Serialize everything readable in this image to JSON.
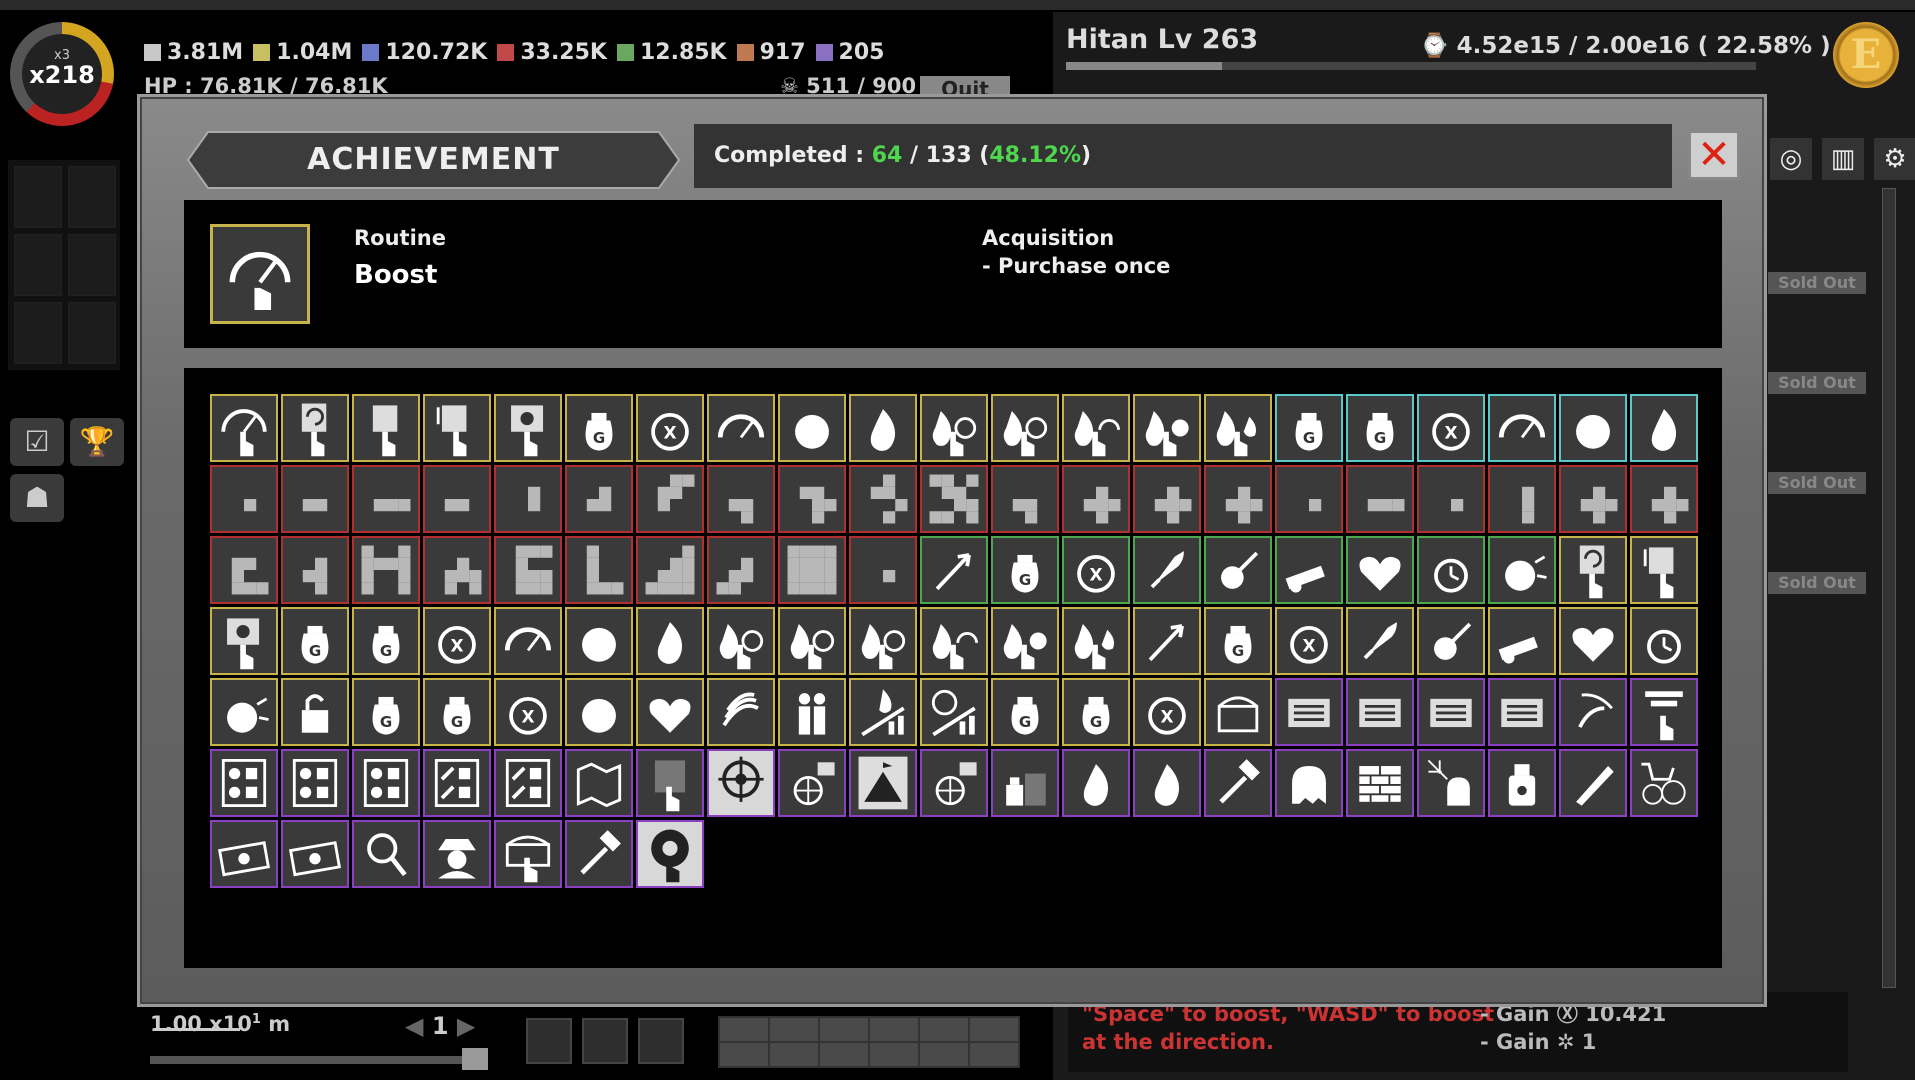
{
  "hud": {
    "multiplier_small": "x3",
    "multiplier_big": "x218",
    "resources": [
      {
        "value": "3.81M",
        "color": "#c8c8c8"
      },
      {
        "value": "1.04M",
        "color": "#c8c060"
      },
      {
        "value": "120.72K",
        "color": "#6a7ac8"
      },
      {
        "value": "33.25K",
        "color": "#c04848"
      },
      {
        "value": "12.85K",
        "color": "#6aa860"
      },
      {
        "value": "917",
        "color": "#c07850"
      },
      {
        "value": "205",
        "color": "#8a70c0"
      }
    ],
    "hp": "HP : 76.81K / 76.81K",
    "kills": "511 / 900",
    "quit_label": "Quit",
    "player": "Hitan  Lv 263",
    "xp": "4.52e15 / 2.00e16  ( 22.58% )",
    "xp_fraction": 0.2258,
    "coin_letter": "E",
    "sold_out": "Sold Out",
    "scale": "1.00 x10",
    "scale_exp": "1",
    "scale_unit": "m",
    "page": "1",
    "hint_line1": "\"Space\" to boost, \"WASD\" to boost",
    "hint_line2": "at the direction.",
    "gain1": "- Gain Ⓧ 10.421",
    "gain2": "- Gain ✲ 1"
  },
  "modal": {
    "title": "ACHIEVEMENT",
    "completed_label": "Completed :",
    "completed_count": "64",
    "completed_total": "/ 133",
    "completed_pct": "48.12%",
    "close_icon": "close-x-icon",
    "accent_green": "#4fd64f",
    "detail": {
      "category": "Routine",
      "name": "Boost",
      "acquisition_title": "Acquisition",
      "acquisition_line": "- Purchase once",
      "icon": "speedometer-hand-icon"
    }
  },
  "achievements": [
    {
      "icon": "speedometer-hand",
      "border": "yellow"
    },
    {
      "icon": "rotate-hand",
      "border": "yellow"
    },
    {
      "icon": "box-hand",
      "border": "yellow"
    },
    {
      "icon": "boxdown-hand",
      "border": "yellow"
    },
    {
      "icon": "gear-hand",
      "border": "yellow"
    },
    {
      "icon": "gold-bag",
      "border": "yellow"
    },
    {
      "icon": "x-bag",
      "border": "yellow"
    },
    {
      "icon": "speedometer",
      "border": "yellow"
    },
    {
      "icon": "ball",
      "border": "yellow"
    },
    {
      "icon": "flame",
      "border": "yellow"
    },
    {
      "icon": "flame-bag",
      "border": "yellow"
    },
    {
      "icon": "flame-x",
      "border": "yellow"
    },
    {
      "icon": "flame-gauge",
      "border": "yellow"
    },
    {
      "icon": "flame-ball",
      "border": "yellow"
    },
    {
      "icon": "flame-flame",
      "border": "yellow"
    },
    {
      "icon": "gold-bag",
      "border": "cyan"
    },
    {
      "icon": "gold-bag",
      "border": "cyan"
    },
    {
      "icon": "x-bag",
      "border": "cyan"
    },
    {
      "icon": "speedometer",
      "border": "cyan"
    },
    {
      "icon": "ball",
      "border": "cyan"
    },
    {
      "icon": "flame",
      "border": "cyan"
    },
    {
      "icon": "pix-a",
      "border": "red"
    },
    {
      "icon": "pix-b",
      "border": "red"
    },
    {
      "icon": "pix-c",
      "border": "red"
    },
    {
      "icon": "pix-b",
      "border": "red"
    },
    {
      "icon": "pix-d",
      "border": "red"
    },
    {
      "icon": "pix-e",
      "border": "red"
    },
    {
      "icon": "pix-f",
      "border": "red"
    },
    {
      "icon": "pix-g",
      "border": "red"
    },
    {
      "icon": "pix-h",
      "border": "red"
    },
    {
      "icon": "pix-i",
      "border": "red"
    },
    {
      "icon": "pix-j",
      "border": "red"
    },
    {
      "icon": "pix-g",
      "border": "red"
    },
    {
      "icon": "pix-plus",
      "border": "red"
    },
    {
      "icon": "pix-plus",
      "border": "red"
    },
    {
      "icon": "pix-plus",
      "border": "red"
    },
    {
      "icon": "pix-a",
      "border": "red"
    },
    {
      "icon": "pix-c",
      "border": "red"
    },
    {
      "icon": "pix-a",
      "border": "red"
    },
    {
      "icon": "pix-k",
      "border": "red"
    },
    {
      "icon": "pix-plus",
      "border": "red"
    },
    {
      "icon": "pix-plus",
      "border": "red"
    },
    {
      "icon": "pix-l",
      "border": "red"
    },
    {
      "icon": "pix-m",
      "border": "red"
    },
    {
      "icon": "pix-n",
      "border": "red"
    },
    {
      "icon": "pix-o",
      "border": "red"
    },
    {
      "icon": "pix-s",
      "border": "red"
    },
    {
      "icon": "pix-p",
      "border": "red"
    },
    {
      "icon": "pix-q",
      "border": "red"
    },
    {
      "icon": "pix-r",
      "border": "red"
    },
    {
      "icon": "pix-block",
      "border": "red"
    },
    {
      "icon": "pix-dot",
      "border": "red"
    },
    {
      "icon": "arrow-up",
      "border": "green"
    },
    {
      "icon": "gold-bag",
      "border": "green"
    },
    {
      "icon": "x-bag",
      "border": "green"
    },
    {
      "icon": "rocket",
      "border": "green"
    },
    {
      "icon": "comet",
      "border": "green"
    },
    {
      "icon": "cannon",
      "border": "green"
    },
    {
      "icon": "heart",
      "border": "green"
    },
    {
      "icon": "clock",
      "border": "green"
    },
    {
      "icon": "explosion",
      "border": "green"
    },
    {
      "icon": "rotate-hand",
      "border": "yellow"
    },
    {
      "icon": "boxdown-hand",
      "border": "yellow"
    },
    {
      "icon": "gear-hand",
      "border": "yellow"
    },
    {
      "icon": "gold-bag",
      "border": "yellow"
    },
    {
      "icon": "gold-bag",
      "border": "yellow"
    },
    {
      "icon": "x-bag",
      "border": "yellow"
    },
    {
      "icon": "speedometer",
      "border": "yellow"
    },
    {
      "icon": "ball",
      "border": "yellow"
    },
    {
      "icon": "flame",
      "border": "yellow"
    },
    {
      "icon": "flame-bag",
      "border": "yellow"
    },
    {
      "icon": "flame-bag",
      "border": "yellow"
    },
    {
      "icon": "flame-x",
      "border": "yellow"
    },
    {
      "icon": "flame-gauge",
      "border": "yellow"
    },
    {
      "icon": "flame-ball",
      "border": "yellow"
    },
    {
      "icon": "flame-flame",
      "border": "yellow"
    },
    {
      "icon": "arrow-up",
      "border": "yellow"
    },
    {
      "icon": "gold-bag",
      "border": "yellow"
    },
    {
      "icon": "x-bag",
      "border": "yellow"
    },
    {
      "icon": "rocket",
      "border": "yellow"
    },
    {
      "icon": "comet",
      "border": "yellow"
    },
    {
      "icon": "cannon",
      "border": "yellow"
    },
    {
      "icon": "heart",
      "border": "yellow"
    },
    {
      "icon": "clock",
      "border": "yellow"
    },
    {
      "icon": "explosion",
      "border": "yellow"
    },
    {
      "icon": "lock-open",
      "border": "yellow"
    },
    {
      "icon": "gold-bag",
      "border": "yellow"
    },
    {
      "icon": "gold-bag",
      "border": "yellow"
    },
    {
      "icon": "x-bag",
      "border": "yellow"
    },
    {
      "icon": "ball",
      "border": "yellow"
    },
    {
      "icon": "heart",
      "border": "yellow"
    },
    {
      "icon": "waves",
      "border": "yellow"
    },
    {
      "icon": "people",
      "border": "yellow"
    },
    {
      "icon": "flame-chart",
      "border": "yellow"
    },
    {
      "icon": "bag-chart",
      "border": "yellow"
    },
    {
      "icon": "gold-bag",
      "border": "yellow"
    },
    {
      "icon": "gold-bag",
      "border": "yellow"
    },
    {
      "icon": "x-bag",
      "border": "yellow"
    },
    {
      "icon": "chest",
      "border": "yellow"
    },
    {
      "icon": "list",
      "border": "purple"
    },
    {
      "icon": "list",
      "border": "purple"
    },
    {
      "icon": "list",
      "border": "purple"
    },
    {
      "icon": "list",
      "border": "purple"
    },
    {
      "icon": "comet-flame",
      "border": "purple"
    },
    {
      "icon": "filter-hand",
      "border": "purple"
    },
    {
      "icon": "hands-box",
      "border": "purple"
    },
    {
      "icon": "hands-box",
      "border": "purple"
    },
    {
      "icon": "hands-box",
      "border": "purple"
    },
    {
      "icon": "hammer-box",
      "border": "purple"
    },
    {
      "icon": "hammer-box",
      "border": "purple"
    },
    {
      "icon": "map",
      "border": "purple"
    },
    {
      "icon": "tile-hand",
      "border": "purple"
    },
    {
      "icon": "target-hand",
      "border": "purple",
      "selected": true
    },
    {
      "icon": "globe",
      "border": "purple"
    },
    {
      "icon": "mountain-hand",
      "border": "purple"
    },
    {
      "icon": "globe",
      "border": "purple"
    },
    {
      "icon": "potion-tile",
      "border": "purple"
    },
    {
      "icon": "flame",
      "border": "purple"
    },
    {
      "icon": "flame",
      "border": "purple"
    },
    {
      "icon": "hammer",
      "border": "purple"
    },
    {
      "icon": "ghost",
      "border": "purple"
    },
    {
      "icon": "bricks",
      "border": "purple"
    },
    {
      "icon": "ghost-web",
      "border": "purple"
    },
    {
      "icon": "potion",
      "border": "purple"
    },
    {
      "icon": "pen",
      "border": "purple"
    },
    {
      "icon": "cart-web",
      "border": "purple"
    },
    {
      "icon": "ticket",
      "border": "purple"
    },
    {
      "icon": "ticket",
      "border": "purple"
    },
    {
      "icon": "magnifier",
      "border": "purple"
    },
    {
      "icon": "spy",
      "border": "purple"
    },
    {
      "icon": "chest-hand",
      "border": "purple"
    },
    {
      "icon": "hammer",
      "border": "purple"
    },
    {
      "icon": "shutter-hand",
      "border": "purple",
      "selected": true
    }
  ]
}
